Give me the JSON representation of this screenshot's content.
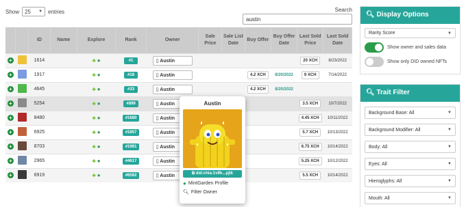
{
  "length": {
    "show_label": "Show",
    "value": "25",
    "entries_label": "entries"
  },
  "search": {
    "label": "Search collection:",
    "value": "austin"
  },
  "columns": [
    "",
    "",
    "ID",
    "Name",
    "Explore",
    "Rank",
    "Owner",
    "Sale Price",
    "Sale List Date",
    "Buy Offer",
    "Buy Offer Date",
    "Last Sold Price",
    "Last Sold Date"
  ],
  "rows": [
    {
      "id": "1614",
      "rank": "#1",
      "owner": "Austin",
      "buy_offer": "",
      "buy_offer_date": "",
      "last_price": "20 XCH",
      "last_date": "8/23/2022",
      "thumb": "#f0c23a"
    },
    {
      "id": "1917",
      "rank": "#18",
      "owner": "Austin",
      "buy_offer": "4.2 XCH",
      "buy_offer_date": "8/20/2022",
      "last_price": "9 XCH",
      "last_date": "7/14/2022",
      "thumb": "#7d9be0"
    },
    {
      "id": "4645",
      "rank": "#33",
      "owner": "Austin",
      "buy_offer": "4.2 XCH",
      "buy_offer_date": "8/20/2022",
      "last_price": "",
      "last_date": "",
      "thumb": "#4fb84a"
    },
    {
      "id": "5254",
      "rank": "#899",
      "owner": "Austin",
      "buy_offer": "",
      "buy_offer_date": "",
      "last_price": "3.5 XCH",
      "last_date": "10/7/2022",
      "thumb": "#8a8a8a"
    },
    {
      "id": "8480",
      "rank": "#1680",
      "owner": "Austin",
      "buy_offer": "",
      "buy_offer_date": "",
      "last_price": "4.45 XCH",
      "last_date": "10/11/2022",
      "thumb": "#b02a2a"
    },
    {
      "id": "6925",
      "rank": "#1857",
      "owner": "Austin",
      "buy_offer": "",
      "buy_offer_date": "",
      "last_price": "5.7 XCH",
      "last_date": "10/13/2022",
      "thumb": "#c2603a"
    },
    {
      "id": "8703",
      "rank": "#1981",
      "owner": "Austin",
      "buy_offer": "",
      "buy_offer_date": "",
      "last_price": "6.75 XCH",
      "last_date": "10/14/2022",
      "thumb": "#6a4a3a"
    },
    {
      "id": "2965",
      "rank": "#4617",
      "owner": "Austin",
      "buy_offer": "",
      "buy_offer_date": "",
      "last_price": "5.25 XCH",
      "last_date": "10/12/2022",
      "thumb": "#7088a8"
    },
    {
      "id": "6919",
      "rank": "#6562",
      "owner": "Austin",
      "buy_offer": "",
      "buy_offer_date": "",
      "last_price": "5.5 XCH",
      "last_date": "10/14/2022",
      "thumb": "#3a3a3a"
    }
  ],
  "popup": {
    "title": "Austin",
    "did": "did:chia:1v9h...pjtk",
    "mintgarden": "MintGarden Profile",
    "filter": "Filter Owner"
  },
  "display_options": {
    "title": "Display Options",
    "sort_select": "Rarity Score",
    "toggle1": "Show owner and sales data",
    "toggle2": "Show only DID owned NFTs",
    "accent": "#26a69a"
  },
  "trait_filter": {
    "title": "Trait Filter",
    "items": [
      "Background Base: All",
      "Background Modifier: All",
      "Body: All",
      "Eyes: All",
      "Hieroglyphs: All",
      "Mouth: All"
    ]
  }
}
